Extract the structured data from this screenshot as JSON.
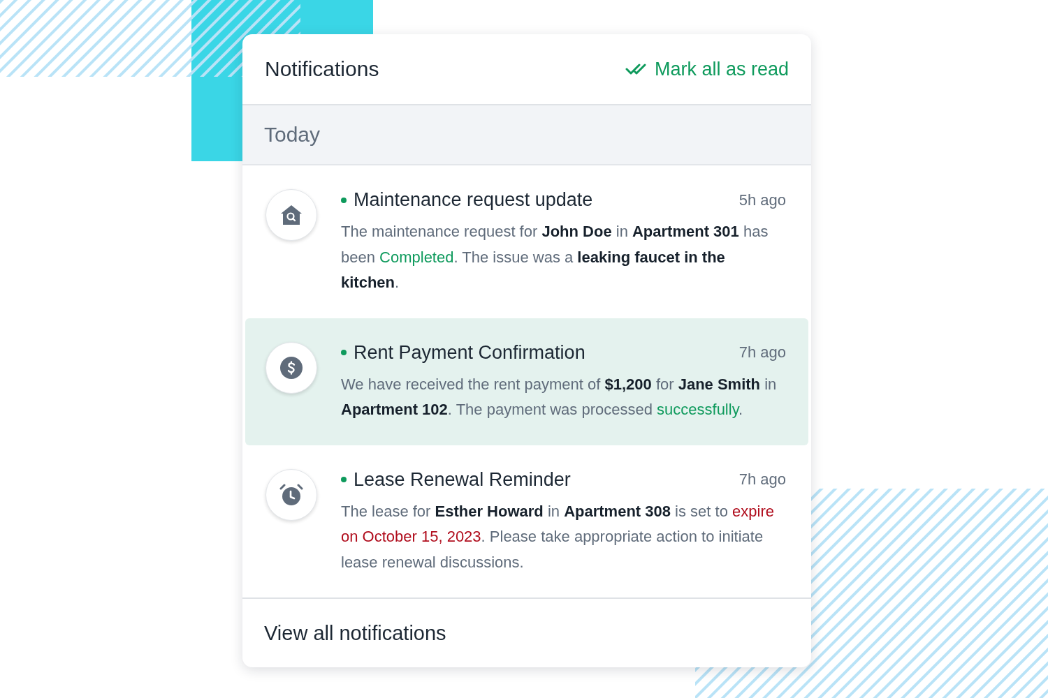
{
  "header": {
    "title": "Notifications",
    "action": "Mark all as read"
  },
  "section": {
    "title": "Today"
  },
  "notifications": [
    {
      "kind": "house",
      "title": "Maintenance request update",
      "time": "5h ago",
      "unread": true,
      "selected": false,
      "body": [
        {
          "kind": "text",
          "text": "The maintenance request for "
        },
        {
          "kind": "strong",
          "text": "John Doe"
        },
        {
          "kind": "text",
          "text": " in "
        },
        {
          "kind": "strong",
          "text": "Apartment 301"
        },
        {
          "kind": "text",
          "text": " has been "
        },
        {
          "kind": "success",
          "text": "Completed"
        },
        {
          "kind": "text",
          "text": ". The issue was a "
        },
        {
          "kind": "strong",
          "text": "leaking faucet in the kitchen"
        },
        {
          "kind": "text",
          "text": "."
        }
      ]
    },
    {
      "kind": "dollar",
      "title": "Rent Payment Confirmation",
      "time": "7h ago",
      "unread": true,
      "selected": true,
      "body": [
        {
          "kind": "text",
          "text": "We have received the rent payment of "
        },
        {
          "kind": "strong",
          "text": "$1,200"
        },
        {
          "kind": "text",
          "text": " for "
        },
        {
          "kind": "strong",
          "text": "Jane Smith"
        },
        {
          "kind": "text",
          "text": " in "
        },
        {
          "kind": "strong",
          "text": "Apartment 102"
        },
        {
          "kind": "text",
          "text": ". The payment was processed "
        },
        {
          "kind": "success",
          "text": "successfully"
        },
        {
          "kind": "text",
          "text": "."
        }
      ]
    },
    {
      "kind": "alarm",
      "title": "Lease Renewal Reminder",
      "time": "7h ago",
      "unread": true,
      "selected": false,
      "body": [
        {
          "kind": "text",
          "text": "The lease for "
        },
        {
          "kind": "strong",
          "text": "Esther Howard"
        },
        {
          "kind": "text",
          "text": " in "
        },
        {
          "kind": "strong",
          "text": "Apartment 308"
        },
        {
          "kind": "text",
          "text": " is set to "
        },
        {
          "kind": "danger",
          "text": "expire on October 15, 2023"
        },
        {
          "kind": "text",
          "text": ". Please take appropriate action to initiate lease renewal discussions."
        }
      ]
    }
  ],
  "footer": {
    "link": "View all notifications"
  }
}
